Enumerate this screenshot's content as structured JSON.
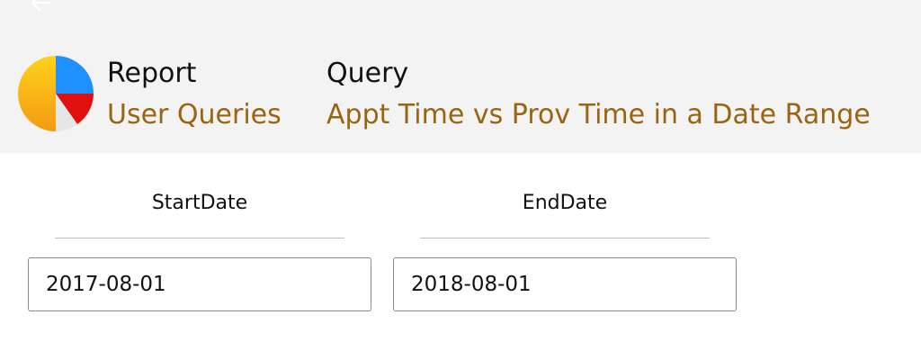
{
  "header": {
    "back_icon": "arrow-left-icon",
    "logo_icon": "pie-chart-icon",
    "report_label": "Report",
    "report_value": "User Queries",
    "query_label": "Query",
    "query_value": "Appt Time vs Prov Time in a Date Range",
    "accent_color": "#9a6410"
  },
  "params": {
    "start": {
      "label": "StartDate",
      "value": "2017-08-01"
    },
    "end": {
      "label": "EndDate",
      "value": "2018-08-01"
    }
  }
}
